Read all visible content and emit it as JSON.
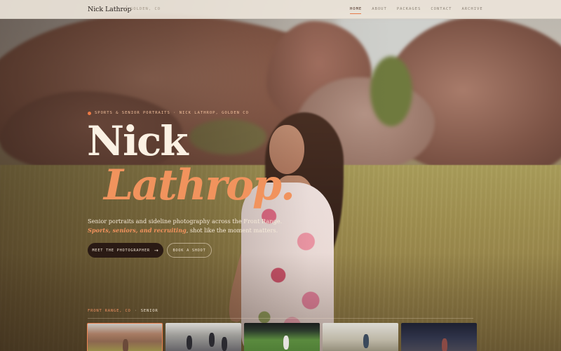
{
  "brand": {
    "name": "Nick Lathrop",
    "separator": "/",
    "location": "GOLDEN, CO"
  },
  "nav": {
    "links": [
      {
        "label": "HOME",
        "active": true
      },
      {
        "label": "ABOUT",
        "active": false
      },
      {
        "label": "PACKAGES",
        "active": false
      },
      {
        "label": "CONTACT",
        "active": false
      },
      {
        "label": "ARCHIVE",
        "active": false
      }
    ]
  },
  "hero": {
    "eyebrow": "SPORTS & SENIOR PORTRAITS · NICK LATHROP, GOLDEN CO",
    "title_line1": "Nick",
    "title_line2": "Lathrop.",
    "lede_line1": "Senior portraits and sideline photography across the Front Range.",
    "lede_accent": "Sports, seniors, and recruiting",
    "lede_rest": ", shot like the moment matters.",
    "cta_primary": "MEET THE PHOTOGRAPHER",
    "cta_primary_icon": "arrow-right-icon",
    "cta_secondary": "BOOK A SHOOT"
  },
  "strip": {
    "location": "FRONT RANGE, CO",
    "separator": "·",
    "category": "SENIOR",
    "thumbnails": [
      {
        "id": "thumb-1",
        "active": true
      },
      {
        "id": "thumb-2",
        "active": false
      },
      {
        "id": "thumb-3",
        "active": false
      },
      {
        "id": "thumb-4",
        "active": false
      },
      {
        "id": "thumb-5",
        "active": false
      }
    ]
  },
  "colors": {
    "accent": "#ee7a45",
    "title_light": "#fbf1e3",
    "title_accent": "#f1935d",
    "nav_bg": "#ece4d9",
    "button_dark": "#2a1a14"
  }
}
